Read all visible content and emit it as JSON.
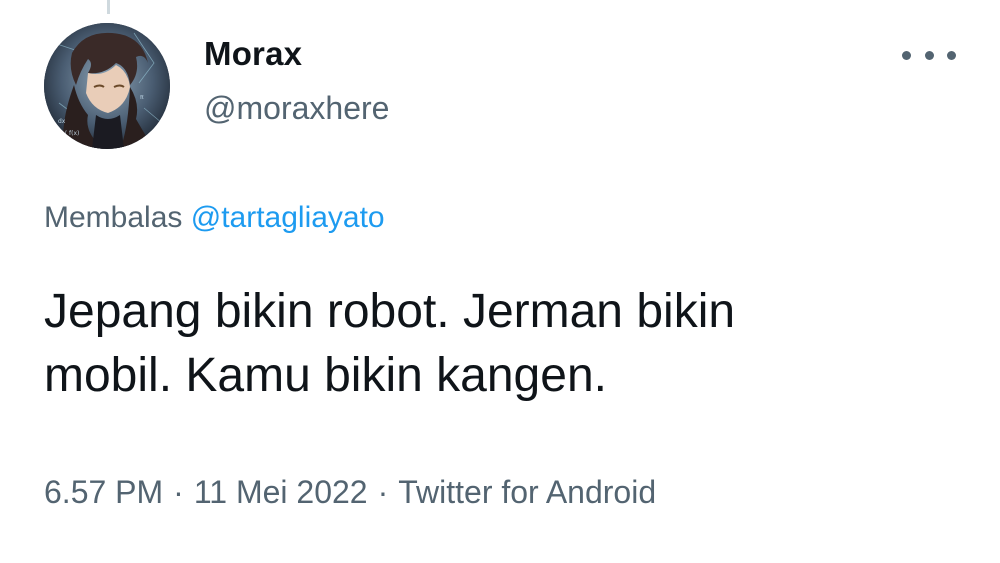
{
  "tweet": {
    "author": {
      "display_name": "Morax",
      "handle": "@moraxhere",
      "avatar_icon": "anime-character-avatar"
    },
    "more_icon": "more-horizontal-icon",
    "reply_context": {
      "prefix": "Membalas",
      "mention": "@tartagliayato"
    },
    "text_lines": [
      "Jepang bikin robot. Jerman bikin",
      "mobil. Kamu bikin kangen."
    ],
    "meta": {
      "time": "6.57 PM",
      "separator": "·",
      "date": "11 Mei 2022",
      "source": "Twitter for Android"
    }
  },
  "colors": {
    "text_primary": "#0f1419",
    "text_secondary": "#536471",
    "link": "#1d9bf0",
    "thread_line": "#cfd9de"
  }
}
